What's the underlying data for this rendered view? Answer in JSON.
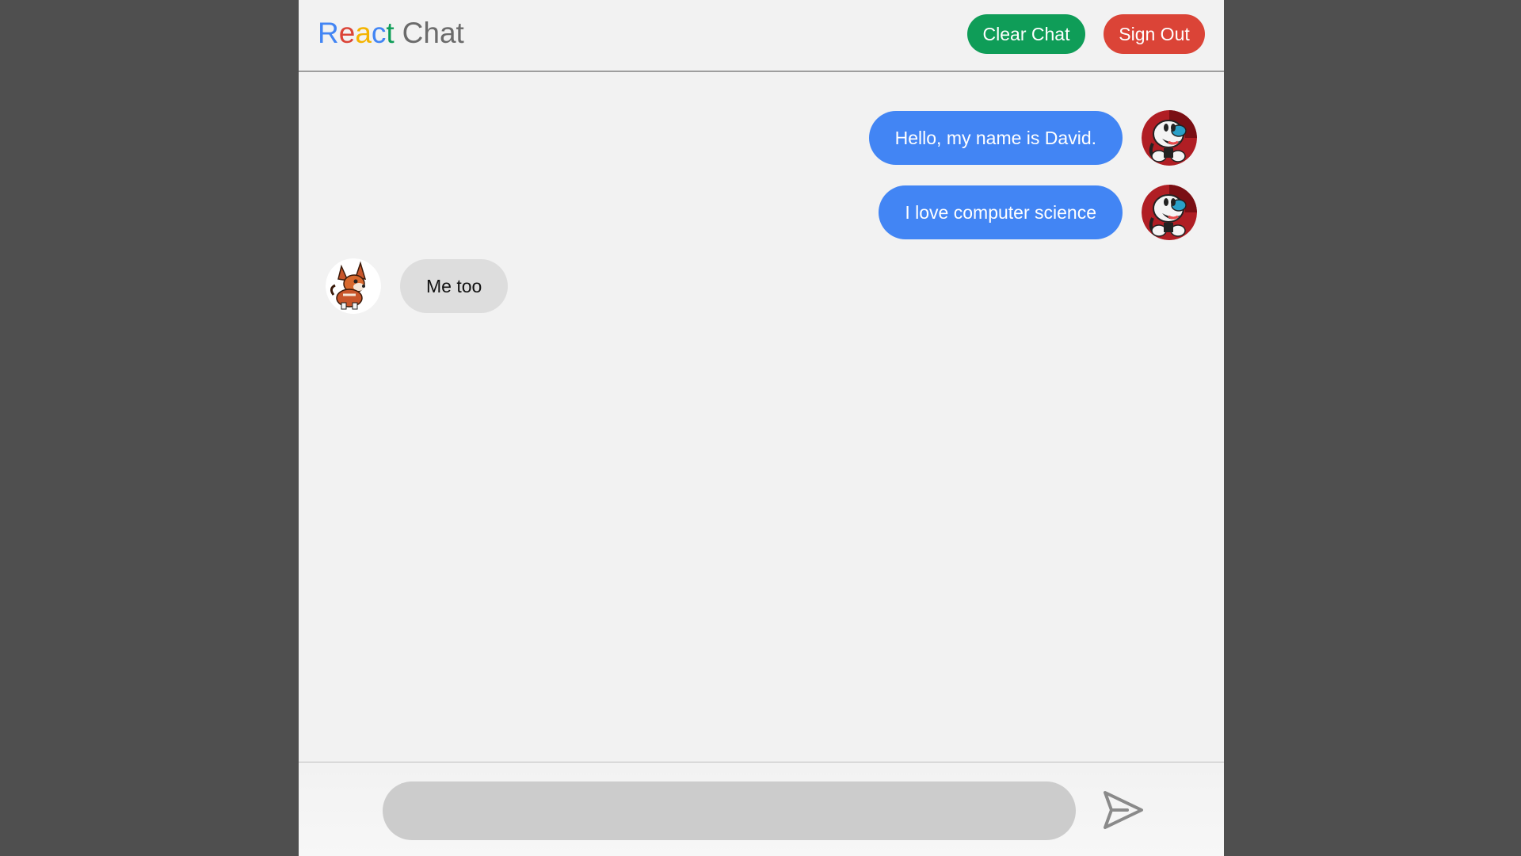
{
  "header": {
    "logo_letters": [
      {
        "char": "R",
        "color": "#4285f4"
      },
      {
        "char": "e",
        "color": "#db4437"
      },
      {
        "char": "a",
        "color": "#f4b400"
      },
      {
        "char": "c",
        "color": "#4285f4"
      },
      {
        "char": "t",
        "color": "#0f9d58"
      }
    ],
    "logo_suffix": "Chat",
    "clear_label": "Clear Chat",
    "signout_label": "Sign Out"
  },
  "messages": [
    {
      "type": "sent",
      "text": "Hello, my name is David.",
      "avatar": "cuphead-avatar"
    },
    {
      "type": "sent",
      "text": "I love computer science",
      "avatar": "cuphead-avatar"
    },
    {
      "type": "received",
      "text": "Me too",
      "avatar": "fox-avatar"
    }
  ],
  "composer": {
    "input_value": "",
    "placeholder": "",
    "send_icon": "send-icon"
  },
  "colors": {
    "sent_bubble": "#4285f4",
    "received_bubble": "#dddddd",
    "clear_button": "#0f9d58",
    "signout_button": "#db4437"
  }
}
